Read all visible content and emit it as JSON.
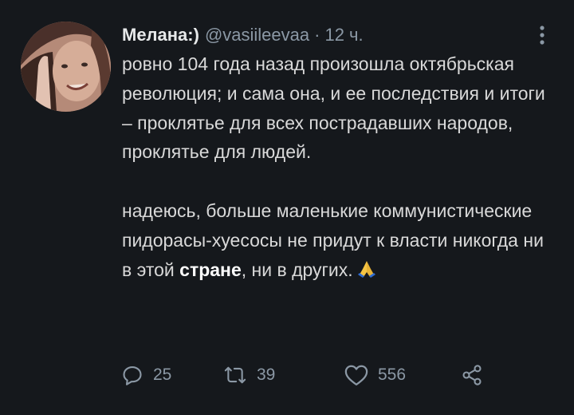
{
  "tweet": {
    "author": {
      "display_name": "Мелана:)",
      "handle": "@vasiileevaa",
      "separator": "·",
      "time": "12 ч."
    },
    "text": {
      "paragraph1": "ровно 104 года назад произошла октябрьская революция; и сама она, и ее последствия и итоги – проклятье для всех пострадавших народов, проклятье для людей.",
      "paragraph2_before": "надеюсь, больше маленькие коммунистические пидорасы-хуесосы не придут к власти никогда ни в этой ",
      "paragraph2_bold": "стране",
      "paragraph2_after": ", ни в других.",
      "emoji": "🙏"
    },
    "actions": {
      "reply_count": "25",
      "retweet_count": "39",
      "like_count": "556"
    }
  },
  "icons": {
    "avatar": "avatar-photo",
    "more": "more-vertical-icon",
    "reply": "reply-icon",
    "retweet": "retweet-icon",
    "like": "heart-icon",
    "share": "share-icon",
    "emoji": "folded-hands-emoji"
  },
  "colors": {
    "background": "#15181c",
    "text": "#d9d9d9",
    "secondary": "#8b98a5"
  }
}
